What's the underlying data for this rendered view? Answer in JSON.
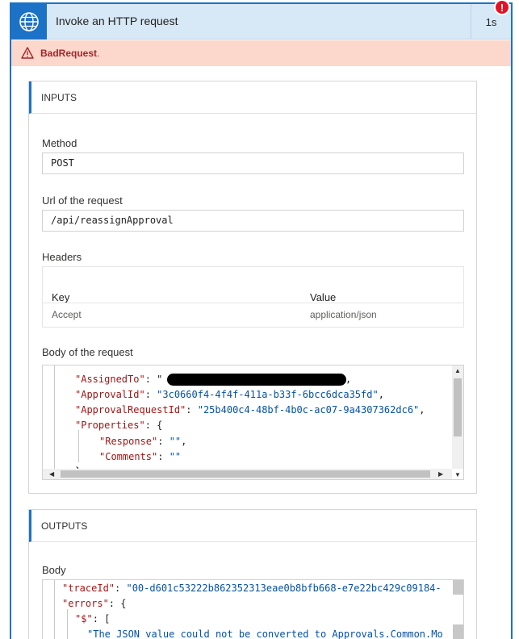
{
  "action": {
    "title": "Invoke an HTTP request",
    "duration": "1s",
    "icon": "globe-icon",
    "error_badge": "!",
    "error_code": "BadRequest",
    "error_suffix": "."
  },
  "inputs": {
    "section_title": "INPUTS",
    "method_label": "Method",
    "method_value": "POST",
    "url_label": "Url of the request",
    "url_value": "/api/reassignApproval",
    "headers_label": "Headers",
    "headers_columns": [
      "Key",
      "Value"
    ],
    "headers_rows": [
      {
        "key": "Accept",
        "value": "application/json"
      }
    ],
    "body_label": "Body of the request",
    "body_lines": [
      {
        "key": "\"AssignedTo\"",
        "sep": ": \"",
        "val": "",
        "tail": ","
      },
      {
        "key": "\"ApprovalId\"",
        "sep": ": ",
        "val": "\"3c0660f4-4f4f-411a-b33f-6bcc6dca35fd\"",
        "tail": ","
      },
      {
        "key": "\"ApprovalRequestId\"",
        "sep": ": ",
        "val": "\"25b400c4-48bf-4b0c-ac07-9a4307362dc6\"",
        "tail": ","
      },
      {
        "key": "\"Properties\"",
        "sep": ": {",
        "val": "",
        "tail": ""
      },
      {
        "key": "\"Response\"",
        "sep": ": ",
        "val": "\"\"",
        "tail": ","
      },
      {
        "key": "\"Comments\"",
        "sep": ": ",
        "val": "\"\"",
        "tail": ""
      },
      {
        "key": "},",
        "sep": "",
        "val": "",
        "tail": ""
      }
    ]
  },
  "outputs": {
    "section_title": "OUTPUTS",
    "body_label": "Body",
    "lines": [
      {
        "key": "\"traceId\"",
        "sep": ": ",
        "val": "\"00-d601c53222b862352313eae0b8bfb668-e7e22bc429c09184-"
      },
      {
        "key": "\"errors\"",
        "sep": ": {",
        "val": ""
      },
      {
        "key": "\"$\"",
        "sep": ": [",
        "val": ""
      },
      {
        "key": "",
        "sep": "",
        "val": "\"The JSON value could not be converted to Approvals.Common.Mo"
      }
    ]
  }
}
